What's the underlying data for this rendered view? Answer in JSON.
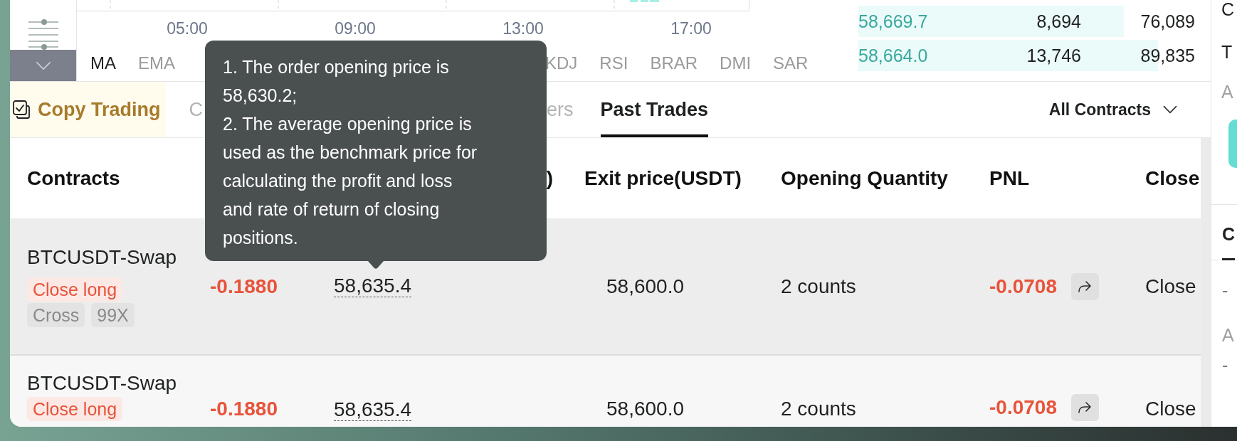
{
  "chart": {
    "time_labels": [
      "05:00",
      "09:00",
      "13:00",
      "17:00"
    ],
    "indicator_tabs": [
      {
        "label": "MA",
        "selected": true
      },
      {
        "label": "EMA",
        "selected": false
      },
      {
        "label": "KDJ",
        "selected": false
      },
      {
        "label": "RSI",
        "selected": false
      },
      {
        "label": "BRAR",
        "selected": false
      },
      {
        "label": "DMI",
        "selected": false
      },
      {
        "label": "SAR",
        "selected": false
      }
    ]
  },
  "order_book": {
    "rows": [
      {
        "price": "58,669.7",
        "amount": "8,694",
        "total": "76,089",
        "level": 0.77
      },
      {
        "price": "58,664.0",
        "amount": "13,746",
        "total": "89,835",
        "level": 0.87
      }
    ]
  },
  "orders_panel": {
    "copy_trading": {
      "label": "Copy Trading"
    },
    "tabs": [
      {
        "label": "C",
        "selected": false
      },
      {
        "label": "ers",
        "selected": false
      },
      {
        "label": "Past Trades",
        "selected": true
      }
    ],
    "filter": {
      "label": "All Contracts"
    }
  },
  "table": {
    "columns": {
      "contract": "Contracts",
      "column_3": ")",
      "exit_price": "Exit price(USDT)",
      "opening_quantity": "Opening Quantity",
      "pnl": "PNL",
      "column_7": "Close"
    },
    "rows": [
      {
        "contract": "BTCUSDT-Swap",
        "tags": [
          {
            "label": "Close long",
            "kind": "side"
          },
          {
            "label": "Cross",
            "kind": "plain"
          },
          {
            "label": "99X",
            "kind": "plain"
          }
        ],
        "column_2": "-0.1880",
        "column_3": "58,635.4",
        "exit_price": "58,600.0",
        "opening_quantity": "2 counts",
        "pnl": "-0.0708",
        "column_7": "Close"
      },
      {
        "contract": "BTCUSDT-Swap",
        "tags": [
          {
            "label": "Close long",
            "kind": "side"
          }
        ],
        "column_2": "-0.1880",
        "column_3": "58,635.4",
        "exit_price": "58,600.0",
        "opening_quantity": "2 counts",
        "pnl": "-0.0708",
        "column_7": "Close"
      }
    ]
  },
  "tooltip": {
    "lines": [
      "1. The order opening price is 58,630.2;",
      "2. The average opening price is used as the benchmark price for calculating the profit and loss and rate of return of closing positions."
    ]
  },
  "side_panel": {
    "header": [
      {
        "text": "C",
        "kind": "title"
      },
      {
        "text": "T",
        "kind": "title"
      },
      {
        "text": "A",
        "kind": "label"
      }
    ],
    "tab": {
      "label": "C",
      "selected": true
    },
    "fields": [
      {
        "text": "-",
        "kind": "value"
      },
      {
        "text": "A",
        "kind": "label"
      },
      {
        "text": "-",
        "kind": "value"
      }
    ]
  }
}
